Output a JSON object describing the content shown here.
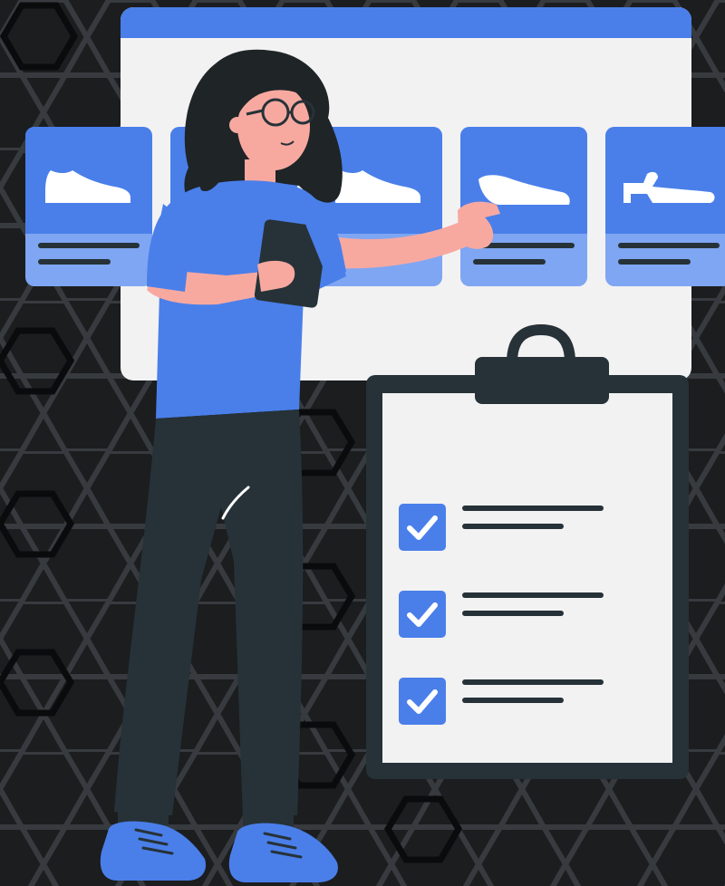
{
  "colors": {
    "background": "#1b1d1f",
    "hex_outline": "#3a3d41",
    "hex_outline_bright": "#0a0b0c",
    "accent": "#4a7fea",
    "accent_light": "#7fa6f2",
    "panel": "#f2f2f2",
    "dark": "#263238",
    "skin": "#f7a9a0",
    "hair": "#1f2427"
  },
  "product_cards": [
    {
      "icon": "sneaker-icon"
    },
    {
      "icon": "sneaker-icon"
    },
    {
      "icon": "sneaker-icon"
    },
    {
      "icon": "loafer-icon"
    },
    {
      "icon": "sandal-icon"
    }
  ],
  "checklist": [
    {
      "checked": true
    },
    {
      "checked": true
    },
    {
      "checked": true
    }
  ]
}
